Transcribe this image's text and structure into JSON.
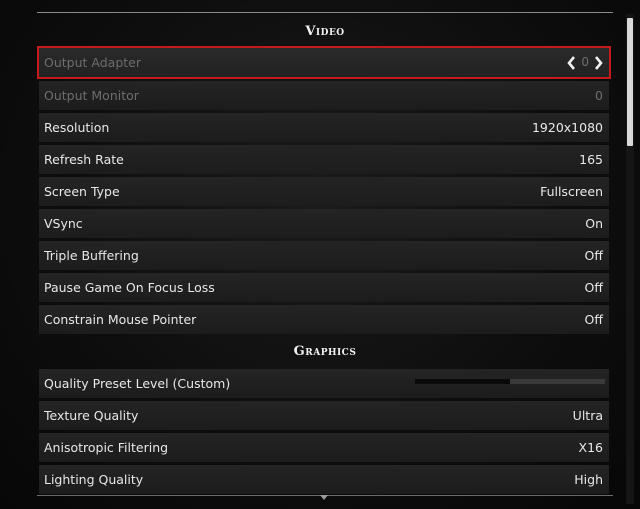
{
  "sections": {
    "video": "Video",
    "graphics": "Graphics"
  },
  "rows": [
    {
      "label": "Output Adapter",
      "value": "0"
    },
    {
      "label": "Output Monitor",
      "value": "0"
    },
    {
      "label": "Resolution",
      "value": "1920x1080"
    },
    {
      "label": "Refresh Rate",
      "value": "165"
    },
    {
      "label": "Screen Type",
      "value": "Fullscreen"
    },
    {
      "label": "VSync",
      "value": "On"
    },
    {
      "label": "Triple Buffering",
      "value": "Off"
    },
    {
      "label": "Pause Game On Focus Loss",
      "value": "Off"
    },
    {
      "label": "Constrain Mouse Pointer",
      "value": "Off"
    },
    {
      "label": "Quality Preset Level (Custom)",
      "value": ""
    },
    {
      "label": "Texture Quality",
      "value": "Ultra"
    },
    {
      "label": "Anisotropic Filtering",
      "value": "X16"
    },
    {
      "label": "Lighting Quality",
      "value": "High"
    }
  ],
  "quality_preset_level": 0.5,
  "icons": {
    "left": "chevron-left-icon",
    "right": "chevron-right-icon",
    "more": "chevron-down-icon"
  },
  "colors": {
    "selection_outline": "#c41a1a"
  }
}
